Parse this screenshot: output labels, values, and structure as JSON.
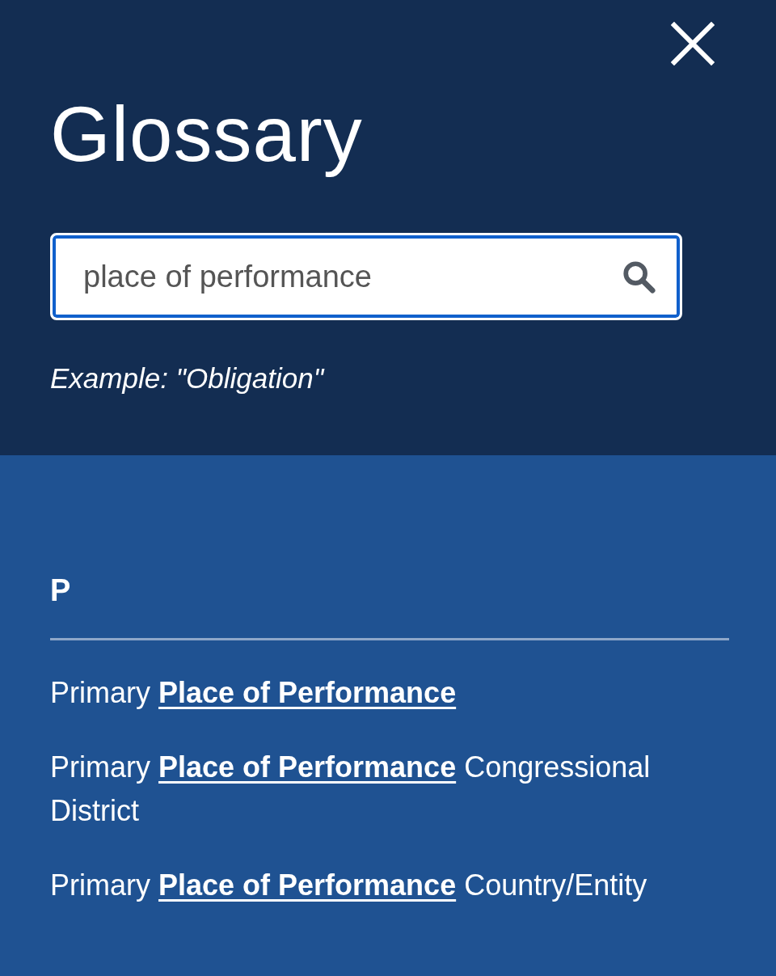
{
  "header": {
    "title": "Glossary",
    "search": {
      "value": "place of performance"
    },
    "example": "Example: \"Obligation\""
  },
  "results": {
    "groups": [
      {
        "letter": "P",
        "terms": [
          "Primary **Place of Performance**",
          "Primary **Place of Performance** Congressional District",
          "Primary **Place of Performance** Country/Entity"
        ]
      }
    ]
  }
}
